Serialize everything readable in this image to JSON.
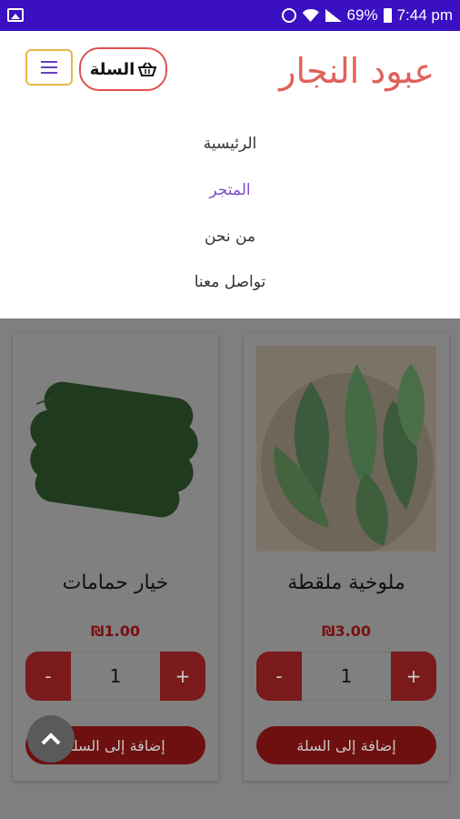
{
  "status_bar": {
    "battery": "69%",
    "time": "7:44 pm"
  },
  "header": {
    "brand": "عبود النجار",
    "cart_label": "السلة"
  },
  "nav": {
    "items": [
      {
        "label": "الرئيسية",
        "active": false
      },
      {
        "label": "المتجر",
        "active": true
      },
      {
        "label": "من نحن",
        "active": false
      },
      {
        "label": "تواصل معنا",
        "active": false
      }
    ]
  },
  "products": [
    {
      "name": "ملوخية ملقطة",
      "price": "₪3.00",
      "quantity": "1",
      "minus_label": "-",
      "plus_label": "+",
      "add_label": "إضافة إلى السلة"
    },
    {
      "name": "خيار حمامات",
      "price": "₪1.00",
      "quantity": "1",
      "minus_label": "-",
      "plus_label": "+",
      "add_label": "إضافة إلى السلة"
    }
  ],
  "colors": {
    "status_bar": "#3a10c2",
    "brand": "#e0615a",
    "nav_active": "#7b4fc9",
    "button": "#c62828"
  }
}
